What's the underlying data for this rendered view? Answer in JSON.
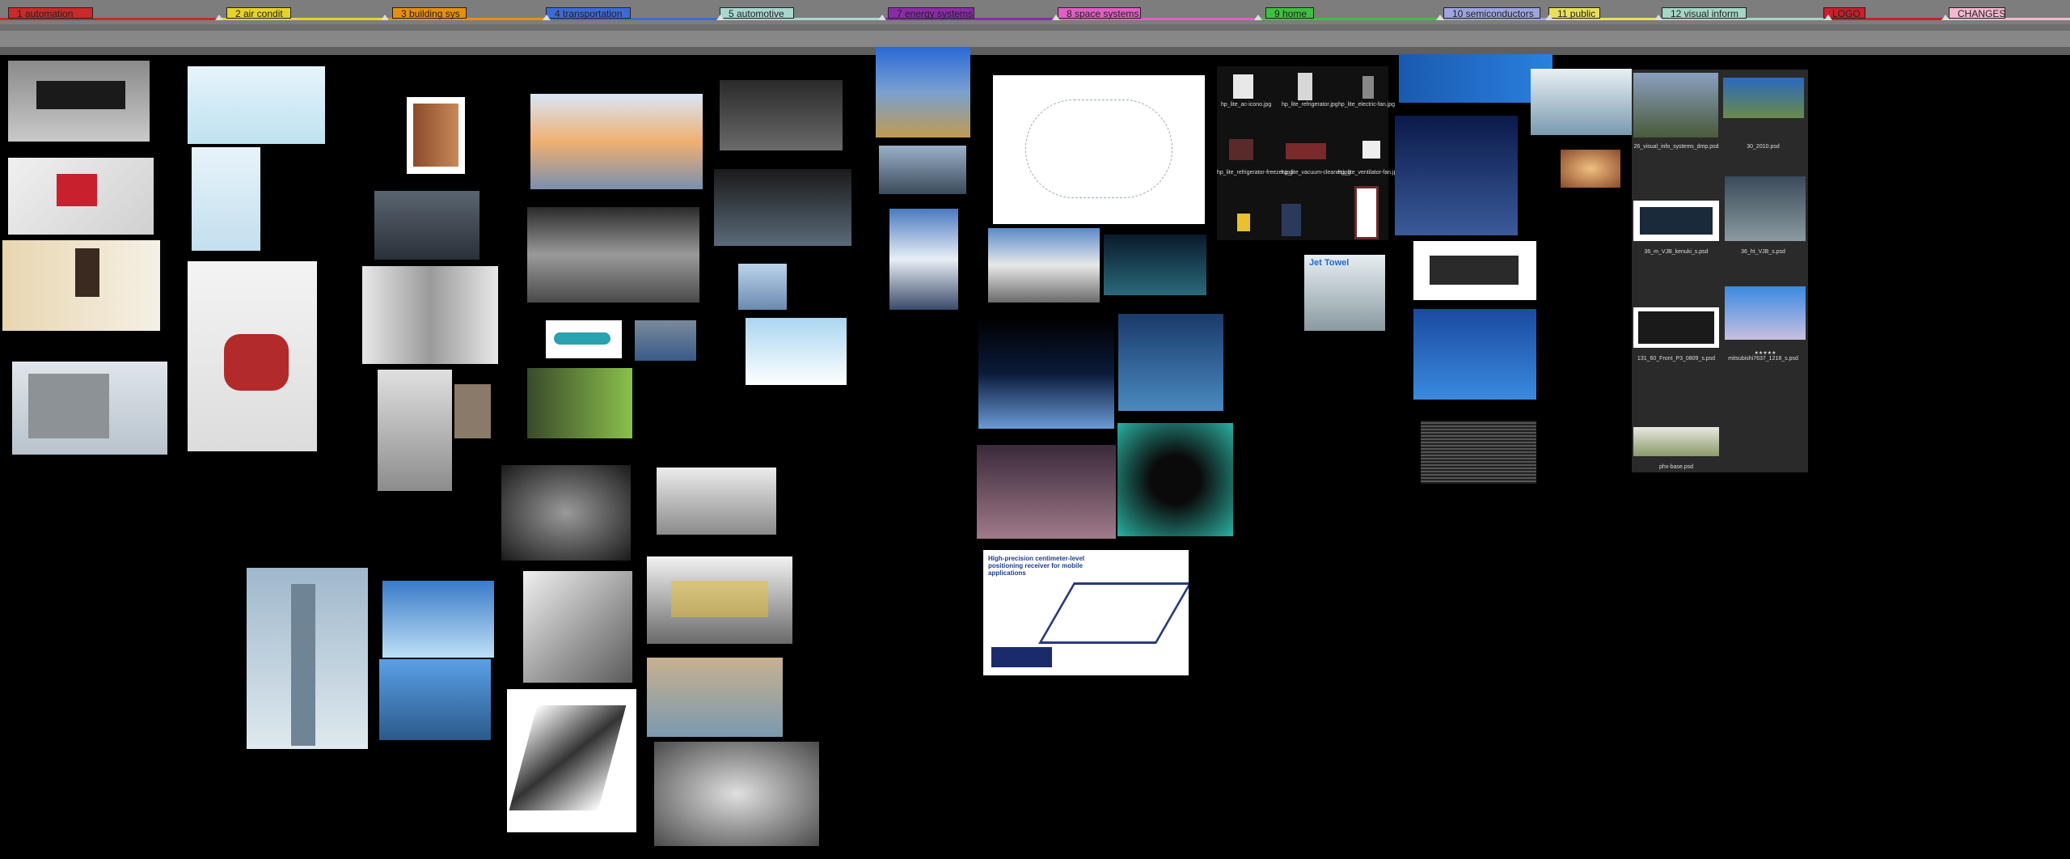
{
  "tabs": [
    {
      "label": "1 automation",
      "color": "#c92a2a"
    },
    {
      "label": "2 air condit",
      "color": "#e6d32a"
    },
    {
      "label": "3 building sys",
      "color": "#e88f12"
    },
    {
      "label": "4 transportation",
      "color": "#3d6bd6"
    },
    {
      "label": "5 automotive",
      "color": "#a8d7cf"
    },
    {
      "label": "7 energy systems",
      "color": "#8b2ba8"
    },
    {
      "label": "8 space systems",
      "color": "#e05fc4"
    },
    {
      "label": "9 home",
      "color": "#3fbf3f"
    },
    {
      "label": "10 semiconductors",
      "color": "#9ea4e0"
    },
    {
      "label": "11 public",
      "color": "#e8e05a"
    },
    {
      "label": "12 visual inform",
      "color": "#a6d6c6"
    },
    {
      "label": "LOGO",
      "color": "#c8202c"
    },
    {
      "label": "CHANGES",
      "color": "#f2b8cf"
    }
  ],
  "thumb_captions": [
    "hp_lite_ac-icono.jpg",
    "hp_lite_refrigerator.jpg",
    "hp_lite_electric-fan.jpg",
    "hp_lite_refrigerator-freezer.jpg",
    "hp_lite_vacuum-cleaner.jpg",
    "hp_lite_ventilator-fan.jpg"
  ],
  "visual_captions": [
    "26_visual_info_systems_dmp.psd",
    "30_2010.psd",
    "36_m_VJB_kenuki_s.psd",
    "36_ht_VJB_s.psd",
    "131_60_Front_P3_0809_s.psd",
    "mitsubishi7637_1218_s.psd",
    "phx-base.psd"
  ],
  "hand_dryer_text": "Jet Towel",
  "space_doc_title": "High-precision centimeter-level positioning receiver for mobile applications",
  "rating_text": "★★★★★"
}
